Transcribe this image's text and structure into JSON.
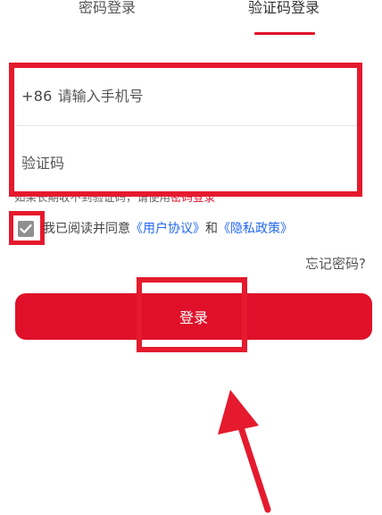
{
  "tabs": [
    {
      "label": "密码登录"
    },
    {
      "label": "验证码登录"
    }
  ],
  "phone": {
    "country_code": "+86",
    "placeholder": "请输入手机号",
    "value": ""
  },
  "code": {
    "placeholder": "验证码",
    "value": ""
  },
  "hint": {
    "prefix": "如果长期收不到验证码，请使用",
    "link": "密码登录"
  },
  "agreement": {
    "checked": true,
    "prefix": "我已阅读并同意",
    "user_agreement": "《用户协议》",
    "conjunction": "和",
    "privacy_policy": "《隐私政策》"
  },
  "forgot_password": "忘记密码?",
  "login_button": "登录",
  "colors": {
    "accent": "#e0102a",
    "highlight": "#e51a2e",
    "link": "#2468f2"
  },
  "icons": [
    "check-icon",
    "pointer-arrow-icon"
  ]
}
